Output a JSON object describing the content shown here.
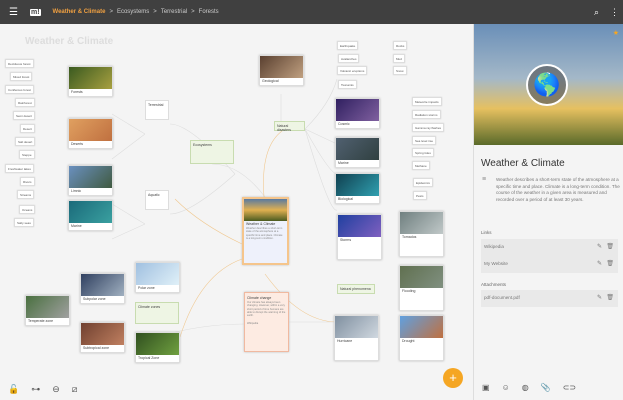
{
  "header": {
    "breadcrumb": [
      "Weather & Climate",
      "Ecosystems",
      "Terrestrial",
      "Forests"
    ],
    "separator": ">"
  },
  "map": {
    "title": "Weather & Climate",
    "labels": [
      "Deciduous forest",
      "Mixed forest",
      "Coniferous forest",
      "Rainforest",
      "Semi desert",
      "Desert",
      "Salt desert",
      "Steppe",
      "Freshwater lakes",
      "Rivers",
      "Streams",
      "Oceans",
      "Salty seas",
      "Earthquake",
      "Avalanches",
      "Volcanic eruptions",
      "Tsunamis",
      "Rocks",
      "Mud",
      "Snow",
      "Meteorite impacts",
      "Radiation storms",
      "Gamma ray flashes",
      "Sea level rise",
      "Spring tides",
      "Methane",
      "Epidemics",
      "Pests"
    ],
    "image_cards": [
      "Forests",
      "Deserts",
      "Limnic",
      "Marine",
      "Geological",
      "Cosmic",
      "Marine",
      "Biological",
      "Polar zone",
      "Subpolar zone",
      "Temperate zone",
      "Subtropical zone",
      "Tropical Zone",
      "Storms",
      "Tornados",
      "Flooding",
      "Hurricane",
      "Drought"
    ],
    "text_nodes": [
      "Terrestrial",
      "Aquatic",
      "Ecosystems",
      "Natural disasters",
      "Natural phenomena",
      "Climate zones"
    ],
    "central": {
      "title": "Weather & Climate",
      "desc": "Weather describes a short-term state of the atmosphere at a specific time and place. Climate is a long-term condition."
    },
    "climate_change": {
      "title": "Climate change",
      "desc": "Our climate has always been changing. However, within a very short period of time humans are able to disrupt the warming of the earth.",
      "footer": "Wikipedia"
    }
  },
  "panel": {
    "title": "Weather & Climate",
    "description": "Weather describes a short-term state of the atmosphere at a specific time and place. Climate is a long-term condition. The course of the weather in a given area is measured and recorded over a period of at least 30 years.",
    "links_label": "Links",
    "links": [
      "Wikipedia",
      "My Website"
    ],
    "attachments_label": "Attachments",
    "attachments": [
      "pdf-document.pdf"
    ]
  },
  "fab": "+"
}
